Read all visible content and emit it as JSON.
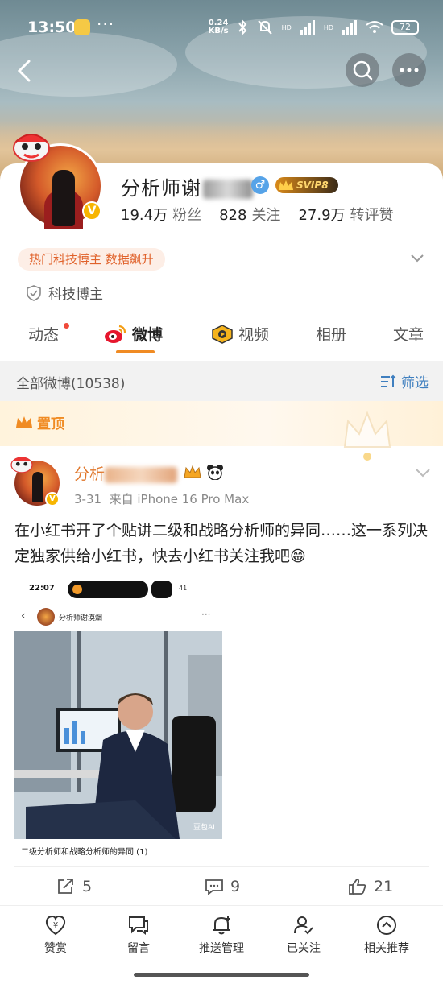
{
  "status_bar": {
    "time": "13:50",
    "dots": "···",
    "network_speed_value": "0.24",
    "network_speed_unit": "KB/s",
    "signal_label_1": "HD",
    "signal_label_2": "HD",
    "battery": "72"
  },
  "profile": {
    "name_visible": "分析师谢",
    "verified_mark": "V",
    "gender_icon": "male-icon",
    "vip_badge": "SVIP8",
    "stats": [
      {
        "number": "19.4万",
        "label": "粉丝"
      },
      {
        "number": "828",
        "label": "关注"
      },
      {
        "number": "27.9万",
        "label": "转评赞"
      }
    ],
    "hot_tag": "热门科技博主 数据飙升",
    "category": "科技博主"
  },
  "tabs": [
    {
      "label": "动态"
    },
    {
      "label": "微博"
    },
    {
      "label": "视频"
    },
    {
      "label": "相册"
    },
    {
      "label": "文章"
    }
  ],
  "active_tab": "微博",
  "filter_bar": {
    "title": "全部微博(10538)",
    "filter_label": "筛选"
  },
  "pinned": {
    "label": "置顶"
  },
  "post": {
    "author_visible": "分析",
    "verified_mark": "V",
    "date": "3-31",
    "source": "来自 iPhone 16 Pro Max",
    "text": "在小红书开了个贴讲二级和战略分析师的异同……这一系列决定独家供给小红书，快去小红书关注我吧😁",
    "embed": {
      "time": "22:07",
      "battery": "41",
      "author": "分析师谢漠烟",
      "more": "···",
      "watermark": "豆包AI",
      "caption": "二级分析师和战略分析师的异同 (1)"
    },
    "actions": [
      {
        "icon": "share-icon",
        "count": "5"
      },
      {
        "icon": "comment-icon",
        "count": "9"
      },
      {
        "icon": "like-icon",
        "count": "21"
      }
    ]
  },
  "bottom_bar": [
    {
      "icon": "reward-icon",
      "label": "赞赏"
    },
    {
      "icon": "message-icon",
      "label": "留言"
    },
    {
      "icon": "bell-icon",
      "label": "推送管理"
    },
    {
      "icon": "following-icon",
      "label": "已关注"
    },
    {
      "icon": "recommend-icon",
      "label": "相关推荐"
    }
  ],
  "colors": {
    "accent_orange": "#f08b23",
    "link_blue": "#3f7fbf",
    "verify_gold": "#f7b500"
  }
}
